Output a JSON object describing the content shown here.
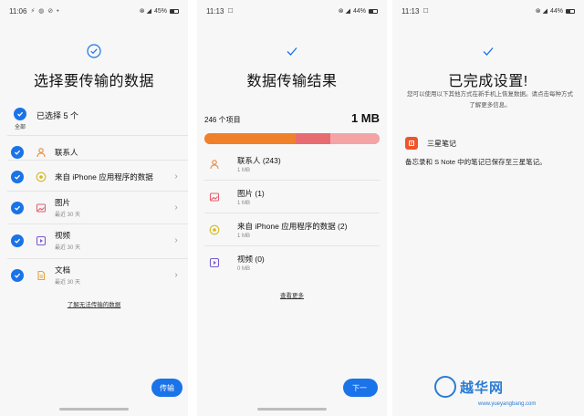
{
  "panel1": {
    "status": {
      "time": "11:06",
      "icons": "⚡ ◍ ⊘ •",
      "signal": "⊗ ◢",
      "battery": "45%"
    },
    "title": "选择要传输的数据",
    "select_all_label": "全部",
    "selected_text": "已选择 5 个",
    "items": [
      {
        "name": "联系人",
        "sub": "",
        "icon": "person-icon",
        "color": "#e88a3a",
        "chevron": false
      },
      {
        "name": "来自 iPhone 应用程序的数据",
        "sub": "",
        "icon": "app-data-icon",
        "color": "#d4b81e",
        "chevron": true
      },
      {
        "name": "图片",
        "sub": "最近 30 天",
        "icon": "image-icon",
        "color": "#e5606b",
        "chevron": true
      },
      {
        "name": "视频",
        "sub": "最近 30 天",
        "icon": "video-icon",
        "color": "#7a5bd1",
        "chevron": true
      },
      {
        "name": "文档",
        "sub": "最近 30 天",
        "icon": "document-icon",
        "color": "#e8a33a",
        "chevron": true
      }
    ],
    "link": "了解无法传输的数据",
    "button": "传输"
  },
  "panel2": {
    "status": {
      "time": "11:13",
      "icons": "☐",
      "signal": "⊗ ◢",
      "battery": "44%"
    },
    "title": "数据传输结果",
    "count": "246 个项目",
    "total_size": "1 MB",
    "bar": [
      {
        "share": 0.52,
        "color": "#f0802a"
      },
      {
        "share": 0.2,
        "color": "#e86b72"
      },
      {
        "share": 0.28,
        "color": "#f4a4a4"
      }
    ],
    "items": [
      {
        "name": "联系人 (243)",
        "sub": "1 MB",
        "icon": "person-icon",
        "color": "#e88a3a"
      },
      {
        "name": "图片 (1)",
        "sub": "1 MB",
        "icon": "image-icon",
        "color": "#e5606b"
      },
      {
        "name": "来自 iPhone 应用程序的数据 (2)",
        "sub": "1 MB",
        "icon": "app-data-icon",
        "color": "#d4b81e"
      },
      {
        "name": "视频 (0)",
        "sub": "0 MB",
        "icon": "video-icon",
        "color": "#7a5bd1"
      }
    ],
    "more": "查看更多",
    "button": "下一"
  },
  "panel3": {
    "status": {
      "time": "11:13",
      "icons": "☐",
      "signal": "⊗ ◢",
      "battery": "44%"
    },
    "title": "已完成设置!",
    "desc": "您可以使用以下其他方式在新手机上恢复数据。请点击每种方式了解更多信息。",
    "app_name": "三星笔记",
    "app_desc": "备忘录和 S Note 中的笔记已保存至三星笔记。"
  },
  "watermark": {
    "text": "越华网",
    "url": "www.yueyangbang.com"
  },
  "accent": "#1a73e8"
}
